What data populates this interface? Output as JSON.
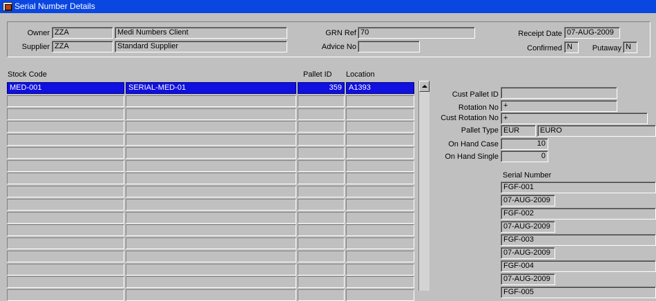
{
  "window": {
    "title": "Serial Number Details"
  },
  "header": {
    "owner_label": "Owner",
    "owner_code": "ZZA",
    "owner_name": "Medi Numbers Client",
    "supplier_label": "Supplier",
    "supplier_code": "ZZA",
    "supplier_name": "Standard Supplier",
    "grn_ref_label": "GRN Ref",
    "grn_ref": "70",
    "advice_no_label": "Advice No",
    "advice_no": "",
    "receipt_date_label": "Receipt Date",
    "receipt_date": "07-AUG-2009",
    "confirmed_label": "Confirmed",
    "confirmed": "N",
    "putaway_label": "Putaway",
    "putaway": "N"
  },
  "grid": {
    "columns": [
      "Stock Code",
      "",
      "Pallet ID",
      "Location"
    ],
    "rows": [
      [
        "MED-001",
        "SERIAL-MED-01",
        "359",
        "A1393"
      ],
      [
        "",
        "",
        "",
        ""
      ],
      [
        "",
        "",
        "",
        ""
      ],
      [
        "",
        "",
        "",
        ""
      ],
      [
        "",
        "",
        "",
        ""
      ],
      [
        "",
        "",
        "",
        ""
      ],
      [
        "",
        "",
        "",
        ""
      ],
      [
        "",
        "",
        "",
        ""
      ],
      [
        "",
        "",
        "",
        ""
      ],
      [
        "",
        "",
        "",
        ""
      ],
      [
        "",
        "",
        "",
        ""
      ],
      [
        "",
        "",
        "",
        ""
      ],
      [
        "",
        "",
        "",
        ""
      ],
      [
        "",
        "",
        "",
        ""
      ],
      [
        "",
        "",
        "",
        ""
      ],
      [
        "",
        "",
        "",
        ""
      ],
      [
        "",
        "",
        "",
        ""
      ]
    ]
  },
  "details": {
    "cust_pallet_id_label": "Cust Pallet ID",
    "cust_pallet_id": "",
    "rotation_no_label": "Rotation No",
    "rotation_no": "+",
    "cust_rotation_no_label": "Cust Rotation No",
    "cust_rotation_no": "+",
    "pallet_type_label": "Pallet Type",
    "pallet_type_code": "EUR",
    "pallet_type_name": "EURO",
    "on_hand_case_label": "On Hand Case",
    "on_hand_case": "10",
    "on_hand_single_label": "On Hand Single",
    "on_hand_single": "0",
    "serial_number_label": "Serial Number"
  },
  "serials": [
    {
      "serial": "FGF-001",
      "date": "07-AUG-2009"
    },
    {
      "serial": "FGF-002",
      "date": "07-AUG-2009"
    },
    {
      "serial": "FGF-003",
      "date": "07-AUG-2009"
    },
    {
      "serial": "FGF-004",
      "date": "07-AUG-2009"
    },
    {
      "serial": "FGF-005",
      "date": ""
    }
  ],
  "colors": {
    "titlebar": "#0a46e0",
    "selected_row": "#1010e0",
    "form_bg": "#c0c0c0"
  },
  "icons": {
    "window_icon": "oracle-forms-icon",
    "scroll_up": "arrow-up-icon"
  }
}
